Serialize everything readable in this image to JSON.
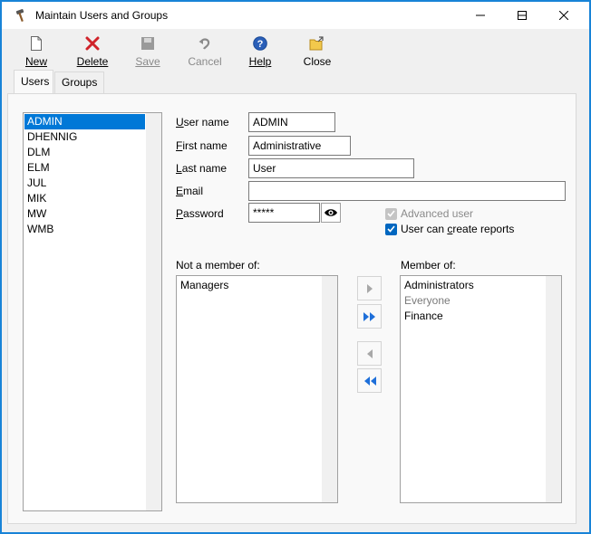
{
  "window": {
    "title": "Maintain Users and Groups"
  },
  "toolbar": {
    "new_label": "New",
    "delete_label": "Delete",
    "save_label": "Save",
    "cancel_label": "Cancel",
    "help_label": "Help",
    "close_label": "Close"
  },
  "tabs": [
    {
      "label": "Users",
      "active": true
    },
    {
      "label": "Groups",
      "active": false
    }
  ],
  "users": [
    "ADMIN",
    "DHENNIG",
    "DLM",
    "ELM",
    "JUL",
    "MIK",
    "MW",
    "WMB"
  ],
  "selected_user": "ADMIN",
  "form": {
    "username_label": "User name",
    "username_value": "ADMIN",
    "firstname_label": "First name",
    "firstname_value": "Administrative",
    "lastname_label": "Last name",
    "lastname_value": "User",
    "email_label": "Email",
    "email_value": "",
    "password_label": "Password",
    "password_value": "*****",
    "advanced_user_label": "Advanced user",
    "advanced_user_checked": true,
    "advanced_user_enabled": false,
    "create_reports_label": "User can create reports",
    "create_reports_checked": true
  },
  "not_member": {
    "label": "Not a member of:",
    "items": [
      "Managers"
    ]
  },
  "member": {
    "label": "Member of:",
    "items": [
      "Administrators",
      "Everyone",
      "Finance"
    ],
    "disabled_items": [
      "Everyone"
    ]
  },
  "colors": {
    "accent": "#0078d7",
    "window_border": "#1883d7",
    "disabled_text": "#8a8a8a",
    "move_arrow": "#1e6fd9",
    "delete_icon": "#d0232a"
  },
  "icons": {
    "title": "hammer-icon",
    "new": "new-document-icon",
    "delete": "delete-x-icon",
    "save": "save-icon",
    "cancel": "undo-icon",
    "help": "help-icon",
    "close": "close-folder-icon",
    "password_toggle": "eye-icon"
  }
}
